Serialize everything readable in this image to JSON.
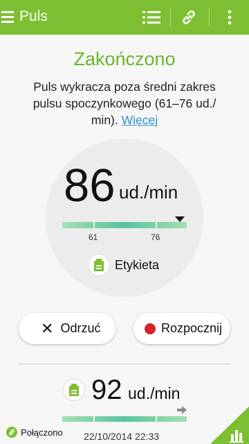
{
  "appbar": {
    "title": "Puls",
    "icons": [
      "menu-icon",
      "list-icon",
      "link-icon",
      "more-vert-icon"
    ]
  },
  "status": {
    "title": "Zakończono",
    "description": "Puls wykracza poza średni zakres pulsu spoczynkowego (61–76 ud./ min). ",
    "more_link": "Więcej"
  },
  "measurement": {
    "value": "86",
    "unit": "ud./min",
    "range_low": "61",
    "range_high": "76",
    "tag_label": "Etykieta"
  },
  "buttons": {
    "discard": "Odrzuć",
    "start": "Rozpocznij"
  },
  "previous": {
    "value": "92",
    "unit": "ud./min"
  },
  "footer": {
    "connection": "Połączono",
    "timestamp": "22/10/2014 22:33"
  },
  "colors": {
    "accent": "#7dbf32",
    "title_green": "#6cb52b",
    "link_blue": "#2f8fd0",
    "record_red": "#d8232a"
  }
}
